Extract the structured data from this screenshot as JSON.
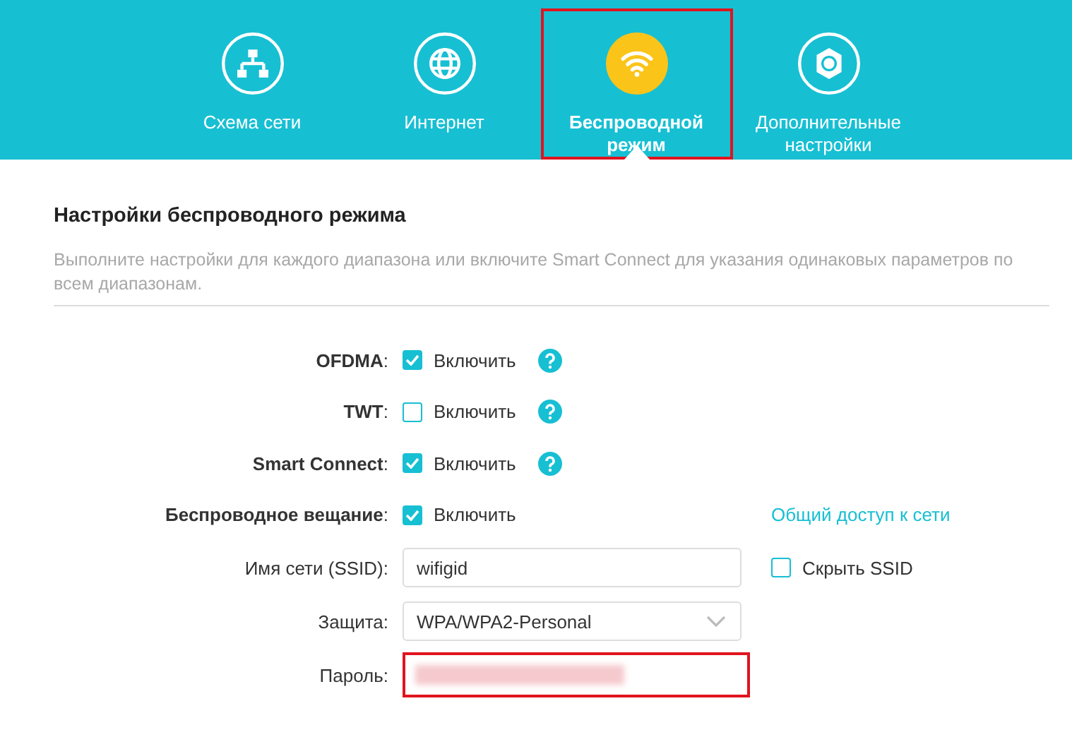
{
  "nav_tabs": [
    {
      "label": "Схема сети",
      "selected": false,
      "highlighted": false
    },
    {
      "label": "Интернет",
      "selected": false,
      "highlighted": false
    },
    {
      "label": "Беспроводной режим",
      "selected": true,
      "highlighted": true
    },
    {
      "label": "Дополнительные настройки",
      "selected": false,
      "highlighted": false
    }
  ],
  "section": {
    "title": "Настройки беспроводного режима",
    "description": "Выполните настройки для каждого диапазона или включите Smart Connect для указания одинаковых параметров по всем диапазонам."
  },
  "rows": [
    {
      "kind": "toggle",
      "label": "**OFDMA**:",
      "checkbox_label": "Включить",
      "checked": true,
      "help": true
    },
    {
      "kind": "toggle",
      "label": "**TWT**:",
      "checkbox_label": "Включить",
      "checked": false,
      "help": true
    },
    {
      "kind": "toggle",
      "label": "**Smart Connect**:",
      "checkbox_label": "Включить",
      "checked": true,
      "help": true
    },
    {
      "kind": "toggle",
      "label": "**Беспроводное вещание**:",
      "checkbox_label": "Включить",
      "checked": true,
      "help": false,
      "link": "Общий доступ к сети"
    },
    {
      "kind": "text",
      "label": "Имя сети (SSID):",
      "value": "wifigid",
      "side_checkbox": {
        "label": "Скрыть SSID",
        "checked": false
      }
    },
    {
      "kind": "select",
      "label": "Защита:",
      "value": "WPA/WPA2-Personal"
    },
    {
      "kind": "password",
      "label": "Пароль:",
      "redacted": true,
      "highlighted": true
    }
  ]
}
